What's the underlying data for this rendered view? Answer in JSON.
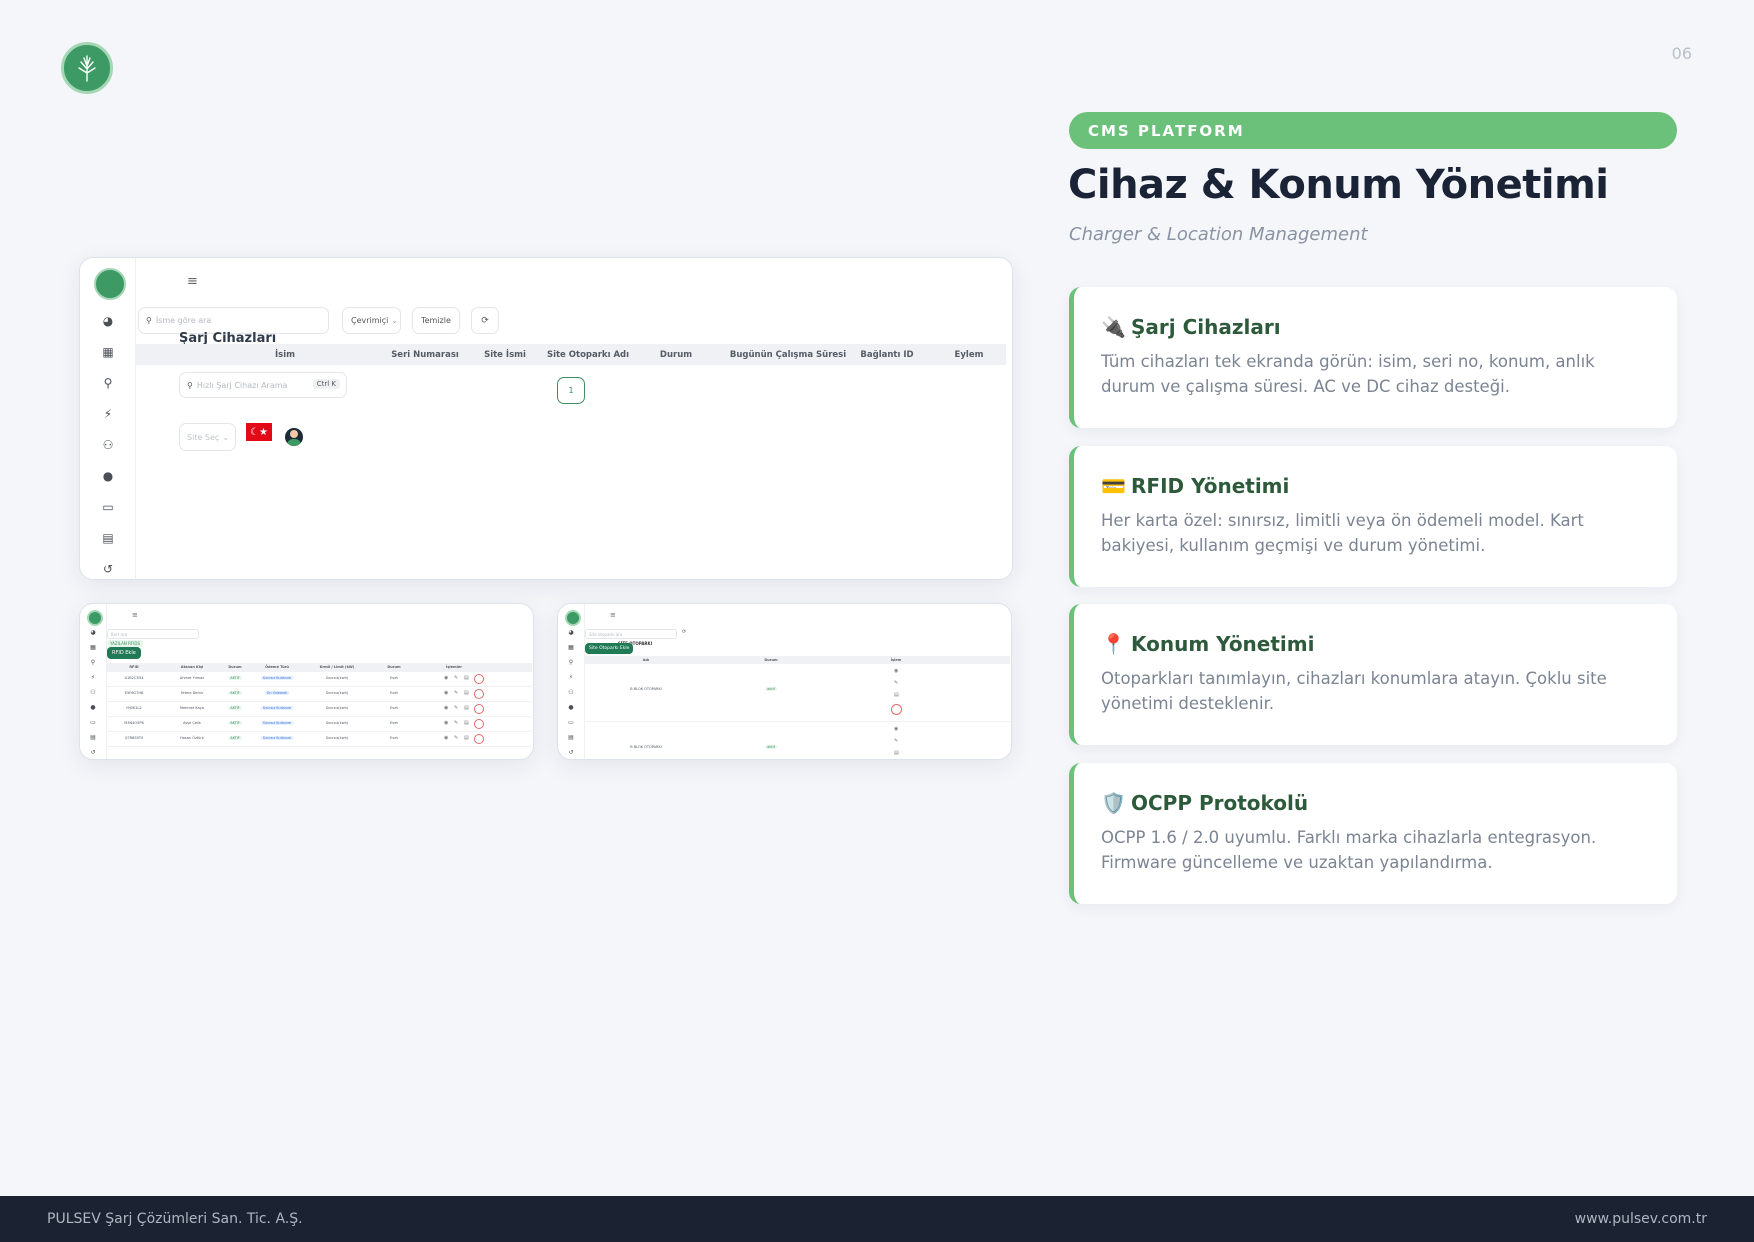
{
  "page": {
    "number": "06",
    "badge": "CMS PLATFORM",
    "title": "Cihaz & Konum Yönetimi",
    "subtitle": "Charger & Location Management",
    "accent_color": "#6cc17a",
    "brand_dark": "#1b2333"
  },
  "cards": [
    {
      "icon": "plug-icon",
      "emoji": "🔌",
      "title": "Şarj Cihazları",
      "body": "Tüm cihazları tek ekranda görün: isim, seri no, konum, anlık durum ve çalışma süresi. AC ve DC cihaz desteği."
    },
    {
      "icon": "credit-card-icon",
      "emoji": "💳",
      "title": "RFID Yönetimi",
      "body": "Her karta özel: sınırsız, limitli veya ön ödemeli model. Kart bakiyesi, kullanım geçmişi ve durum yönetimi."
    },
    {
      "icon": "pin-icon",
      "emoji": "📍",
      "title": "Konum Yönetimi",
      "body": "Otoparkları tanımlayın, cihazları konumlara atayın. Çoklu site yönetimi desteklenir."
    },
    {
      "icon": "shield-icon",
      "emoji": "🛡️",
      "title": "OCPP Protokolü",
      "body": "OCPP 1.6 / 2.0 uyumlu. Farklı marka cihazlarla entegrasyon. Firmware güncelleme ve uzaktan yapılandırma."
    }
  ],
  "footer": {
    "company": "PULSEV Şarj Çözümleri San. Tic. A.Ş.",
    "website": "www.pulsev.com.tr"
  },
  "main_screenshot": {
    "menu_icon": "≡",
    "search_placeholder": "İsme göre ara",
    "status_filter": "Çevrimiçi",
    "clear_button": "Temizle",
    "refresh_icon": "⟳",
    "page_title": "Şarj Cihazları",
    "columns": [
      "İsim",
      "Seri Numarası",
      "Site İsmi",
      "Site Otoparkı Adı",
      "Durum",
      "Bugünün Çalışma Süresi",
      "Bağlantı ID",
      "Eylem"
    ],
    "quick_search_placeholder": "Hızlı Şarj Cihazı Arama",
    "shortcut": "Ctrl K",
    "page_number": "1",
    "site_select": "Site Seç",
    "sidebar_icons": [
      "dashboard-icon",
      "building-icon",
      "location-icon",
      "charger-icon",
      "users-icon",
      "user-icon",
      "card-icon",
      "receipt-icon",
      "history-icon"
    ]
  },
  "rfid_screenshot": {
    "search_placeholder": "Kart ara",
    "chip": "YAZILAN RFIDS",
    "add_button": "RFID Ekle",
    "columns": [
      "RFID",
      "Atanan Kişi",
      "Durum",
      "Ödeme Türü",
      "Kredi / Limit (kW)",
      "Durum",
      "İşlemler"
    ],
    "rows": [
      {
        "rfid": "A1B2C3D4",
        "person": "Ahmet Yılmaz",
        "status": "AKTİF",
        "payment": "Sınırsız Kullanım",
        "limit": "Sınırsız(kwh)",
        "state": "Evet"
      },
      {
        "rfid": "E5F6G7H8",
        "person": "Fatma Demir",
        "status": "AKTİF",
        "payment": "Ön Ödemeli",
        "limit": "Sınırsız(kwh)",
        "state": "Evet"
      },
      {
        "rfid": "I9J0K1L2",
        "person": "Mehmet Kaya",
        "status": "AKTİF",
        "payment": "Sınırsız Kullanım",
        "limit": "Sınırsız(kwh)",
        "state": "Evet"
      },
      {
        "rfid": "M3N4O5P6",
        "person": "Ayşe Çelik",
        "status": "AKTİF",
        "payment": "Sınırsız Kullanım",
        "limit": "Sınırsız(kwh)",
        "state": "Evet"
      },
      {
        "rfid": "Q7R8S9T0",
        "person": "Hasan Öztürk",
        "status": "AKTİF",
        "payment": "Sınırsız Kullanım",
        "limit": "Sınırsız(kwh)",
        "state": "Evet"
      }
    ]
  },
  "location_screenshot": {
    "search_placeholder": "Site otoparkı ara",
    "add_button": "Site Otoparkı Ekle",
    "heading": "SİTE OTOPARKI",
    "columns": [
      "Adı",
      "Durum",
      "İşlem"
    ],
    "rows": [
      {
        "name": "B BLOK OTOPARKI",
        "status": "aktif"
      },
      {
        "name": "B BLOK OTOPARKI",
        "status": "aktif"
      }
    ]
  }
}
